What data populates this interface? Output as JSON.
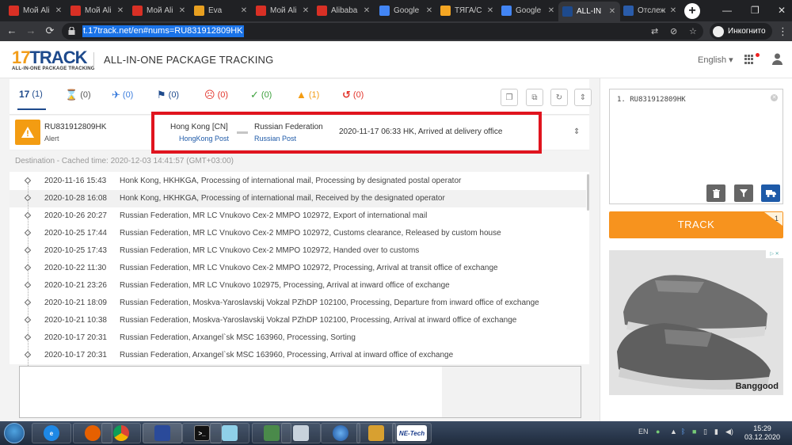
{
  "browser": {
    "tabs": [
      {
        "title": "Мой Ali",
        "icon": "gmail-icon",
        "color": "#d93025",
        "active": false
      },
      {
        "title": "Мой Ali",
        "icon": "gmail-icon",
        "color": "#d93025",
        "active": false
      },
      {
        "title": "Мой Ali",
        "icon": "gmail-icon",
        "color": "#d93025",
        "active": false
      },
      {
        "title": "Eva",
        "icon": "eva-icon",
        "color": "#e8a020",
        "active": false
      },
      {
        "title": "Мой Ali",
        "icon": "gmail-icon",
        "color": "#d93025",
        "active": false
      },
      {
        "title": "Alibaba",
        "icon": "gmail-icon",
        "color": "#d93025",
        "active": false
      },
      {
        "title": "Google",
        "icon": "google-translate-icon",
        "color": "#4285f4",
        "active": false
      },
      {
        "title": "ТЯГА/С",
        "icon": "tyaga-icon",
        "color": "#f5a623",
        "active": false
      },
      {
        "title": "Google",
        "icon": "google-translate-icon",
        "color": "#4285f4",
        "active": false
      },
      {
        "title": "ALL-IN",
        "icon": "17track-icon",
        "color": "#1e4a8c",
        "active": true
      },
      {
        "title": "Отслеж",
        "icon": "tracking-icon",
        "color": "#2a5caa",
        "active": false
      }
    ],
    "url": "t.17track.net/en#nums=RU831912809HK",
    "incognito_label": "Инкогнито"
  },
  "header": {
    "logo_main": "17TRACK",
    "logo_sub": "ALL-IN-ONE PACKAGE TRACKING",
    "title": "ALL-IN-ONE PACKAGE TRACKING",
    "language": "English"
  },
  "filters": [
    {
      "icon": "17track-icon",
      "count": "(1)",
      "color": "#1e4a8c",
      "active": true
    },
    {
      "icon": "hourglass-icon",
      "count": "(0)",
      "color": "#555",
      "active": false
    },
    {
      "icon": "plane-icon",
      "count": "(0)",
      "color": "#3b7ddd",
      "active": false
    },
    {
      "icon": "flag-icon",
      "count": "(0)",
      "color": "#1e4a8c",
      "active": false
    },
    {
      "icon": "sad-face-icon",
      "count": "(0)",
      "color": "#e2342b",
      "active": false
    },
    {
      "icon": "check-icon",
      "count": "(0)",
      "color": "#3da13d",
      "active": false
    },
    {
      "icon": "warning-icon",
      "count": "(1)",
      "color": "#f39c12",
      "active": false
    },
    {
      "icon": "history-icon",
      "count": "(0)",
      "color": "#e2342b",
      "active": false
    }
  ],
  "result": {
    "tracking_number": "RU831912809HK",
    "status": "Alert",
    "origin_country": "Hong Kong [CN]",
    "origin_carrier": "HongKong Post",
    "destination_country": "Russian Federation",
    "destination_carrier": "Russian Post",
    "latest_event": "2020-11-17 06:33  HK, Arrived at delivery office",
    "destination_note": "Destination - Cached time: 2020-12-03 14:41:57 (GMT+03:00)"
  },
  "events": [
    {
      "time": "2020-11-16 15:43",
      "desc": "Honk Kong, HKHKGA, Processing of international mail, Processing by designated postal operator"
    },
    {
      "time": "2020-10-28 16:08",
      "desc": "Honk Kong, HKHKGA, Processing of international mail, Received by the designated operator"
    },
    {
      "time": "2020-10-26 20:27",
      "desc": "Russian Federation, MR LC Vnukovo Сех-2 MMPO 102972, Export of international mail"
    },
    {
      "time": "2020-10-25 17:44",
      "desc": "Russian Federation, MR LC Vnukovo Сех-2 MMPO 102972, Customs clearance, Released by custom house"
    },
    {
      "time": "2020-10-25 17:43",
      "desc": "Russian Federation, MR LC Vnukovo Сех-2 MMPO 102972, Handed over to customs"
    },
    {
      "time": "2020-10-22 11:30",
      "desc": "Russian Federation, MR LC Vnukovo Сех-2 MMPO 102972, Processing, Arrival at transit office of exchange"
    },
    {
      "time": "2020-10-21 23:26",
      "desc": "Russian Federation, MR LC Vnukovo 102975, Processing, Arrival at inward office of exchange"
    },
    {
      "time": "2020-10-21 18:09",
      "desc": "Russian Federation, Moskva-Yaroslavskij Vokzal PZhDP 102100, Processing, Departure from inward office of exchange"
    },
    {
      "time": "2020-10-21 10:38",
      "desc": "Russian Federation, Moskva-Yaroslavskij Vokzal PZhDP 102100, Processing, Arrival at inward office of exchange"
    },
    {
      "time": "2020-10-17 20:31",
      "desc": "Russian Federation, Arxangel`sk MSC 163960, Processing, Sorting"
    },
    {
      "time": "2020-10-17 20:31",
      "desc": "Russian Federation, Arxangel`sk MSC 163960, Processing, Arrival at inward office of exchange"
    }
  ],
  "sidebar": {
    "input_value": "1. RU831912809HK",
    "track_label": "TRACK",
    "track_count": "1",
    "ad_brand": "Banggood"
  },
  "taskbar": {
    "language": "EN",
    "time": "15:29",
    "date": "03.12.2020"
  }
}
